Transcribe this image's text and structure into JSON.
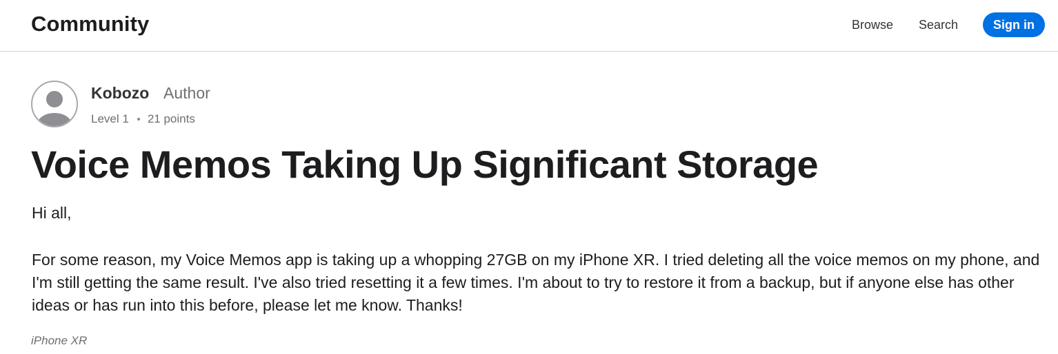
{
  "header": {
    "brand": "Community",
    "nav": {
      "browse": "Browse",
      "search": "Search"
    },
    "sign_in": "Sign in"
  },
  "author": {
    "avatar_icon": "user-avatar-icon",
    "name": "Kobozo",
    "role": "Author",
    "level": "Level 1",
    "points": "21 points"
  },
  "post": {
    "title": "Voice Memos Taking Up Significant Storage",
    "greeting": "Hi all,",
    "body": "For some reason, my Voice Memos app is taking up a whopping 27GB on my iPhone XR. I tried deleting all the voice memos on my phone, and I'm still getting the same result. I've also tried resetting it a few times. I'm about to try to restore it from a backup, but if anyone else has other ideas or has run into this before, please let me know. Thanks!",
    "device": "iPhone XR"
  },
  "colors": {
    "accent": "#0071e3",
    "text_primary": "#1d1d1f",
    "text_secondary": "#6e6e73",
    "divider": "#d2d2d7"
  }
}
